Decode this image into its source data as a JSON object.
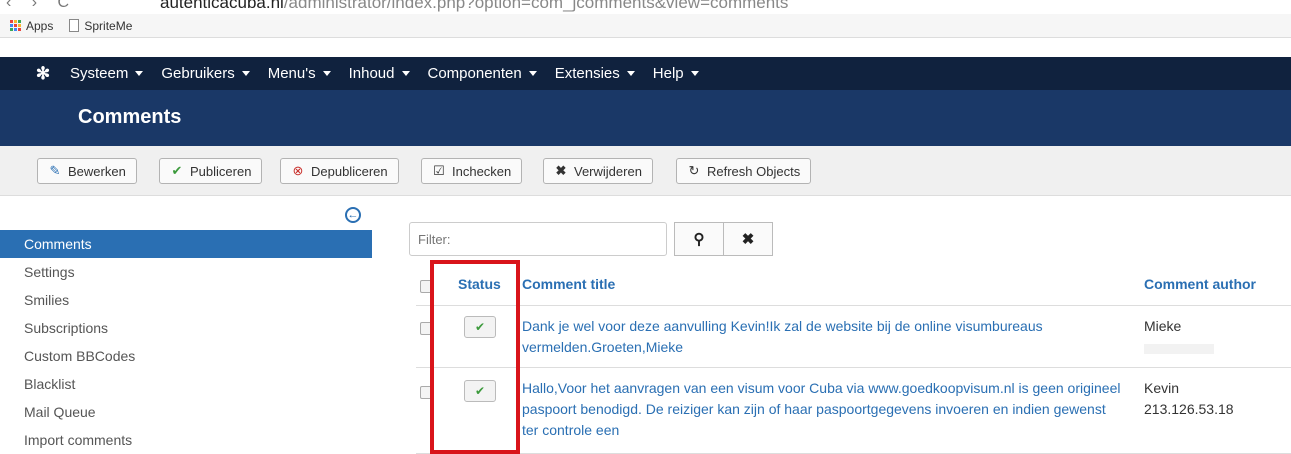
{
  "browser": {
    "url_host": "autenticacuba.nl",
    "url_path": "/administrator/index.php?option=com_jcomments&view=comments"
  },
  "bookmarks": [
    {
      "label": "Apps",
      "icon": "apps-grid-icon"
    },
    {
      "label": "SpriteMe",
      "icon": "page-icon"
    }
  ],
  "topnav": {
    "logo_icon": "joomla-icon",
    "menus": [
      "Systeem",
      "Gebruikers",
      "Menu's",
      "Inhoud",
      "Componenten",
      "Extensies",
      "Help"
    ]
  },
  "header": {
    "title": "Comments"
  },
  "toolbar": {
    "buttons": [
      {
        "label": "Bewerken",
        "icon": "edit-icon",
        "glyph": "✎",
        "color": "#2a6fb3"
      },
      {
        "label": "Publiceren",
        "icon": "check-icon",
        "glyph": "✔",
        "color": "#3c9a3c"
      },
      {
        "label": "Depubliceren",
        "icon": "unpublish-icon",
        "glyph": "✖",
        "color": "#c9302c"
      },
      {
        "label": "Inchecken",
        "icon": "checkin-icon",
        "glyph": "☑",
        "color": "#333333"
      },
      {
        "label": "Verwijderen",
        "icon": "delete-icon",
        "glyph": "✖",
        "color": "#222222"
      },
      {
        "label": "Refresh Objects",
        "icon": "refresh-icon",
        "glyph": "↻",
        "color": "#222222"
      }
    ]
  },
  "sidebar": {
    "collapse_icon": "collapse-left-icon",
    "items": [
      "Comments",
      "Settings",
      "Smilies",
      "Subscriptions",
      "Custom BBCodes",
      "Blacklist",
      "Mail Queue",
      "Import comments"
    ],
    "active_index": 0
  },
  "filter": {
    "placeholder": "Filter:",
    "search_icon": "search-icon",
    "clear_icon": "clear-icon"
  },
  "table": {
    "headers": {
      "status": "Status",
      "title": "Comment title",
      "author": "Comment author"
    },
    "rows": [
      {
        "published": true,
        "title": "Dank je wel voor deze aanvulling Kevin!Ik zal de website bij de online visumbureaus vermelden.Groeten,Mieke",
        "author": "Mieke",
        "ip": ""
      },
      {
        "published": true,
        "title": "Hallo,Voor het aanvragen van een visum voor Cuba via www.goedkoopvisum.nl is geen origineel paspoort benodigd. De reiziger kan zijn of haar paspoortgegevens invoeren en indien gewenst ter controle een",
        "author": "Kevin",
        "ip": "213.126.53.18"
      }
    ]
  },
  "colors": {
    "nav_bg": "#10223e",
    "header_bg": "#1a3867",
    "accent": "#2a6fb3",
    "highlight": "#d9141a"
  }
}
